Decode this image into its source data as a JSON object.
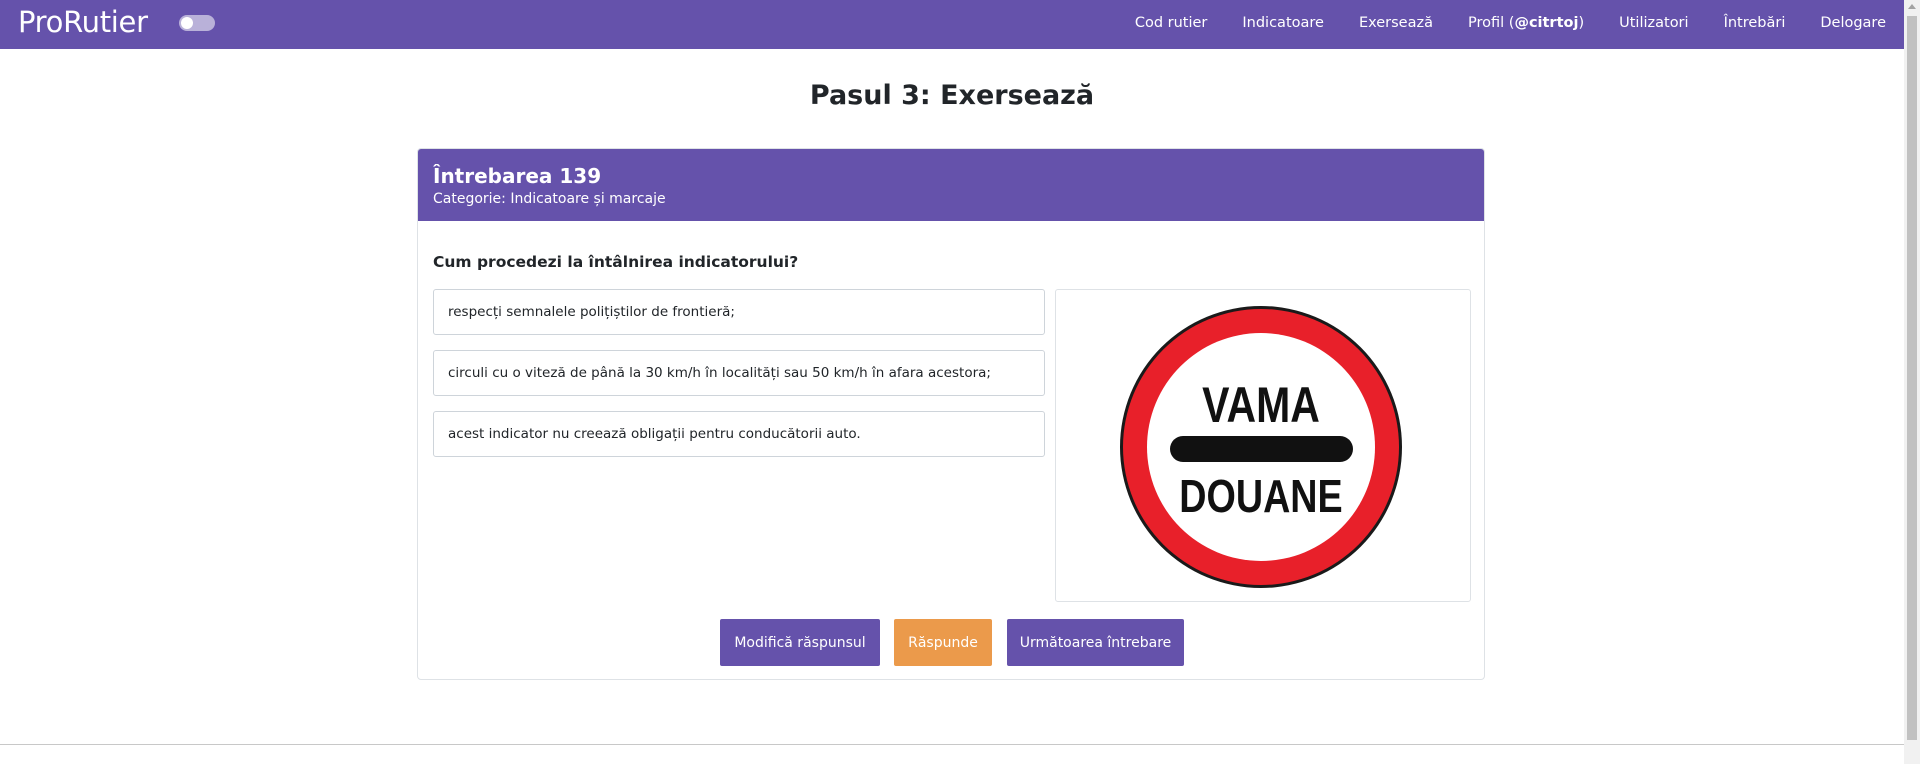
{
  "app": {
    "brand": "ProRutier"
  },
  "nav": {
    "items": [
      {
        "label": "Cod rutier"
      },
      {
        "label": "Indicatoare"
      },
      {
        "label": "Exersează"
      },
      {
        "label_prefix": "Profil (",
        "label_user": "@citrtoj",
        "label_suffix": ")"
      },
      {
        "label": "Utilizatori"
      },
      {
        "label": "Întrebări"
      },
      {
        "label": "Delogare"
      }
    ]
  },
  "page": {
    "title": "Pasul 3: Exersează"
  },
  "question": {
    "number_label": "Întrebarea 139",
    "category_label": "Categorie: Indicatoare și marcaje",
    "text": "Cum procedezi la întâlnirea indicatorului?",
    "answers": [
      {
        "text": "respecți semnalele polițiștilor de frontieră;"
      },
      {
        "text": "circuli cu o viteză de până la 30 km/h în localități sau 50 km/h în afara acestora;"
      },
      {
        "text": "acest indicator nu creează obligații pentru conducătorii auto."
      }
    ],
    "sign": {
      "line1": "VAMA",
      "line2": "DOUANE"
    }
  },
  "actions": {
    "modify_label": "Modifică răspunsul",
    "answer_label": "Răspunde",
    "next_label": "Următoarea întrebare"
  },
  "colors": {
    "primary": "#6552ab",
    "accent": "#eb9a4b",
    "sign_red": "#e8202a"
  },
  "icons": {
    "theme_toggle": "moon-toggle-icon"
  }
}
